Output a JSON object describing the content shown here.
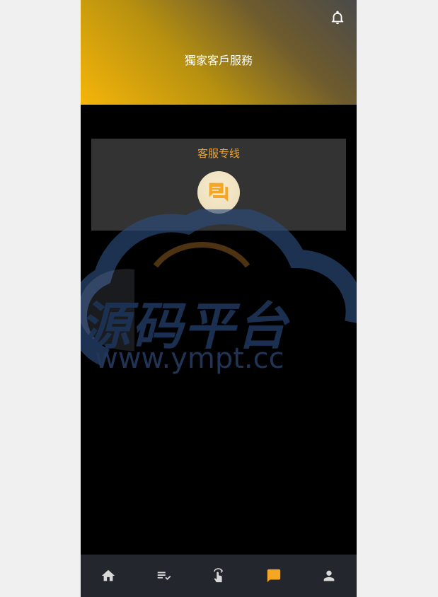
{
  "header": {
    "title": "獨家客戶服務",
    "bell_icon": "bell-icon"
  },
  "service_card": {
    "title": "客服专线",
    "chat_icon": "chat-icon"
  },
  "watermark": {
    "line1": "源码平台",
    "line2": "www.ympt.cc"
  },
  "bottom_nav": {
    "items": [
      {
        "icon": "home-icon",
        "active": false
      },
      {
        "icon": "task-list-icon",
        "active": false
      },
      {
        "icon": "tap-swipe-icon",
        "active": false
      },
      {
        "icon": "chat-icon",
        "active": true
      },
      {
        "icon": "person-icon",
        "active": false
      }
    ]
  },
  "colors": {
    "accent": "#f5a623",
    "page_bg": "#000000",
    "card_bg": "#333333",
    "nav_bg": "#23262c"
  }
}
